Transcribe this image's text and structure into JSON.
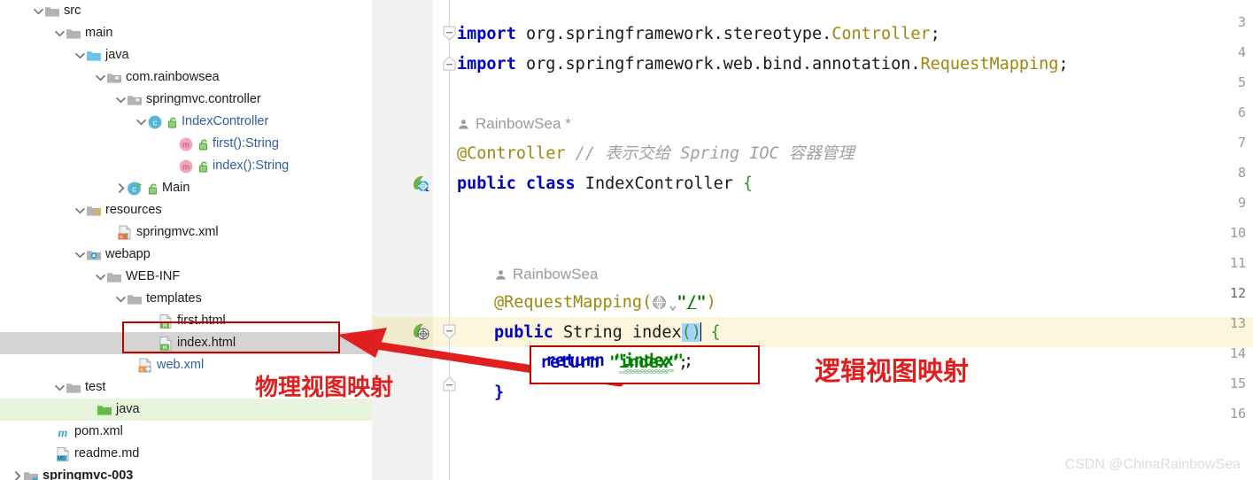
{
  "tree": {
    "items": [
      {
        "indent": 55,
        "arrow": "down",
        "icon": "folder-gray",
        "label": "src",
        "style": "plain",
        "state": "normal"
      },
      {
        "indent": 79,
        "arrow": "down",
        "icon": "folder-gray",
        "label": "main",
        "style": "plain",
        "state": "normal"
      },
      {
        "indent": 102,
        "arrow": "down",
        "icon": "folder-blue",
        "label": "java",
        "style": "plain",
        "state": "normal"
      },
      {
        "indent": 125,
        "arrow": "down",
        "icon": "package",
        "label": "com.rainbowsea",
        "style": "plain",
        "state": "normal"
      },
      {
        "indent": 148,
        "arrow": "down",
        "icon": "package",
        "label": "springmvc.controller",
        "style": "plain",
        "state": "normal"
      },
      {
        "indent": 171,
        "arrow": "down",
        "icon": "class",
        "lock": true,
        "label": "IndexController",
        "style": "blue",
        "state": "normal"
      },
      {
        "indent": 206,
        "arrow": "none",
        "icon": "method",
        "lock": true,
        "label": "first():String",
        "style": "blue",
        "state": "normal"
      },
      {
        "indent": 206,
        "arrow": "none",
        "icon": "method",
        "lock": true,
        "label": "index():String",
        "style": "blue",
        "state": "normal"
      },
      {
        "indent": 148,
        "arrow": "right",
        "icon": "class-run",
        "lock": true,
        "label": "Main",
        "style": "plain",
        "state": "normal"
      },
      {
        "indent": 102,
        "arrow": "down",
        "icon": "folder-resources",
        "label": "resources",
        "style": "plain",
        "state": "normal"
      },
      {
        "indent": 137,
        "arrow": "none",
        "icon": "file-spring-xml",
        "label": "springmvc.xml",
        "style": "plain",
        "state": "normal"
      },
      {
        "indent": 102,
        "arrow": "down",
        "icon": "folder-webapp",
        "label": "webapp",
        "style": "plain",
        "state": "normal"
      },
      {
        "indent": 125,
        "arrow": "down",
        "icon": "folder-gray",
        "label": "WEB-INF",
        "style": "plain",
        "state": "normal"
      },
      {
        "indent": 148,
        "arrow": "down",
        "icon": "folder-gray",
        "label": "templates",
        "style": "plain",
        "state": "normal"
      },
      {
        "indent": 183,
        "arrow": "none",
        "icon": "file-html",
        "label": "first.html",
        "style": "plain",
        "state": "normal"
      },
      {
        "indent": 183,
        "arrow": "none",
        "icon": "file-html",
        "label": "index.html",
        "style": "plain",
        "state": "selected"
      },
      {
        "indent": 160,
        "arrow": "none",
        "icon": "file-web-xml",
        "label": "web.xml",
        "style": "blue",
        "state": "normal"
      },
      {
        "indent": 79,
        "arrow": "down",
        "icon": "folder-gray",
        "label": "test",
        "style": "plain",
        "state": "normal"
      },
      {
        "indent": 114,
        "arrow": "none",
        "icon": "folder-green",
        "label": "java",
        "style": "plain",
        "state": "green"
      },
      {
        "indent": 67,
        "arrow": "none",
        "icon": "file-maven",
        "label": "pom.xml",
        "style": "plain",
        "state": "normal"
      },
      {
        "indent": 67,
        "arrow": "none",
        "icon": "file-md",
        "label": "readme.md",
        "style": "plain",
        "state": "normal"
      },
      {
        "indent": 31,
        "arrow": "right",
        "icon": "module",
        "label": "springmvc-003",
        "style": "bold",
        "state": "normal"
      }
    ]
  },
  "editor": {
    "gutter_numbers": [
      "3",
      "4",
      "5",
      "6",
      "7",
      "8",
      "9",
      "10",
      "11",
      "12",
      "13",
      "14",
      "15",
      "16"
    ],
    "current_line": "12",
    "lines": {
      "import1_kw": "import",
      "import1_pkg": " org.springframework.stereotype.",
      "import1_cls": "Controller",
      "import1_end": ";",
      "import2_kw": "import",
      "import2_pkg": " org.springframework.web.bind.annotation.",
      "import2_cls": "RequestMapping",
      "import2_end": ";",
      "author1": "RainbowSea *",
      "annotation_controller": "@Controller",
      "comment_controller": "// 表示交给 Spring IOC 容器管理",
      "class_decl_kw1": "public",
      "class_decl_kw2": "class",
      "class_decl_name": " IndexController ",
      "class_decl_brace": "{",
      "author2": "RainbowSea",
      "requestmapping_head": "@RequestMapping(",
      "requestmapping_quote_open": "\"",
      "requestmapping_path": "/",
      "requestmapping_quote_close": "\"",
      "requestmapping_tail": ")",
      "method_kw1": "public",
      "method_type": " String ",
      "method_name": "index",
      "method_parens": "()",
      "method_brace": " {",
      "return_kw": "return",
      "return_str_open": " \"",
      "return_str_val": "index",
      "return_str_close": "\"",
      "return_semi": ";",
      "close_brace": "}"
    }
  },
  "annotations": {
    "physical_view_label": "物理视图映射",
    "logical_view_label": "逻辑视图映射",
    "watermark": "CSDN @ChinaRainbowSea"
  },
  "colors": {
    "selection_gray": "#d4d4d4",
    "green_row": "#e8f5dd",
    "current_line_yellow": "#fdf6dd",
    "annotation_red": "#e02020",
    "box_red": "#c00000",
    "keyword_blue": "#0000c0",
    "string_green": "#008000",
    "annotation_gold": "#9e880d"
  }
}
